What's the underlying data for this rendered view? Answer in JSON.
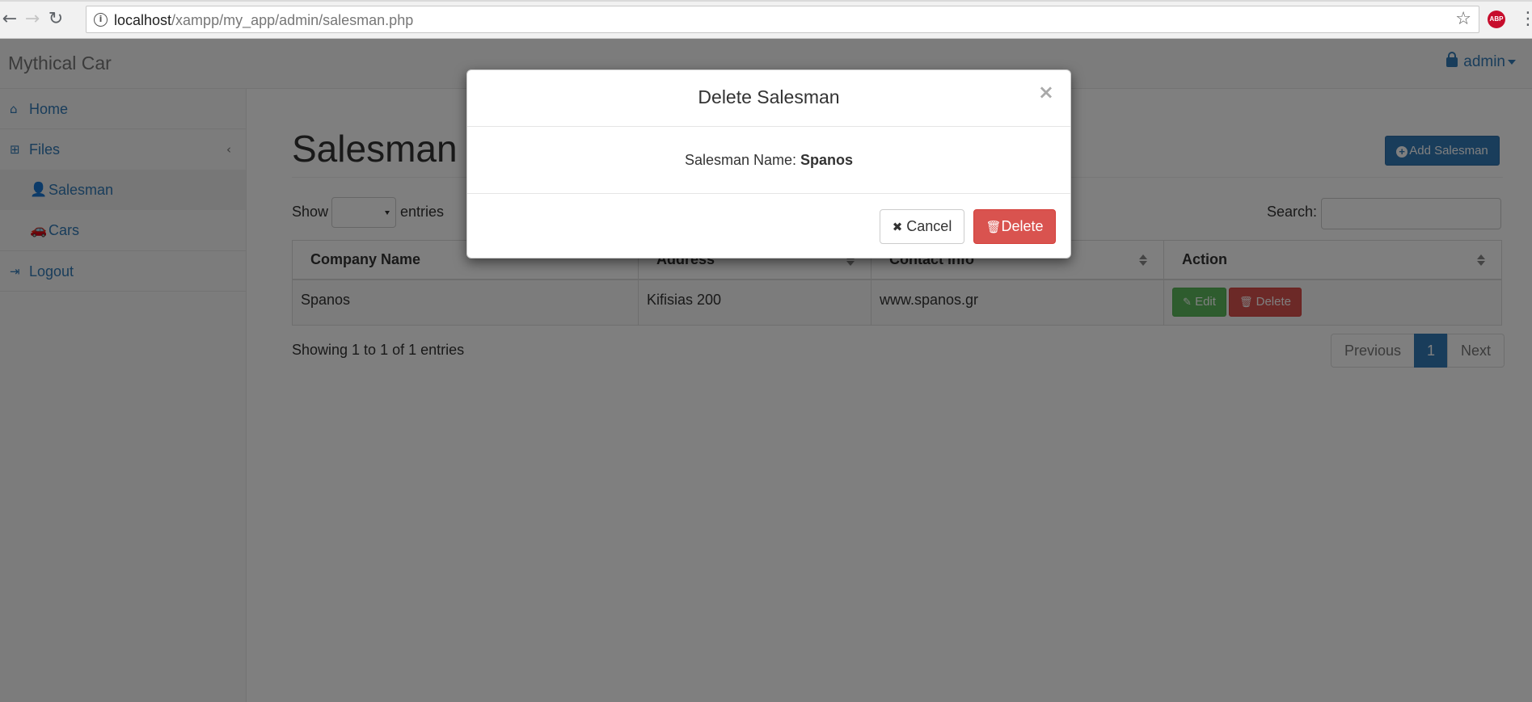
{
  "browser": {
    "url_host": "localhost",
    "url_path": "/xampp/my_app/admin/salesman.php",
    "back_icon": "arrow-left-icon",
    "forward_icon": "arrow-right-icon",
    "reload_icon": "reload-icon",
    "adblock_label": "ABP"
  },
  "app": {
    "brand": "Mythical Car",
    "user": "admin"
  },
  "sidebar": {
    "home": "Home",
    "files": "Files",
    "salesman": "Salesman",
    "cars": "Cars",
    "logout": "Logout"
  },
  "page": {
    "title": "Salesman",
    "add_button": "Add Salesman",
    "show_label": "Show",
    "entries_label": "entries",
    "length_value": "",
    "search_label": "Search:",
    "search_value": ""
  },
  "table": {
    "columns": [
      "Company Name",
      "Address",
      "Contact info",
      "Action"
    ],
    "rows": [
      {
        "company": "Spanos",
        "address": "Kifisias 200",
        "contact": "www.spanos.gr",
        "edit": "Edit",
        "delete": "Delete"
      }
    ]
  },
  "footer": {
    "info": "Showing 1 to 1 of 1 entries",
    "previous": "Previous",
    "page": "1",
    "next": "Next"
  },
  "modal": {
    "title": "Delete Salesman",
    "close": "×",
    "label": "Salesman Name:",
    "value": "Spanos",
    "cancel": "Cancel",
    "confirm": "Delete"
  },
  "colors": {
    "primary": "#337ab7",
    "success": "#5cb85c",
    "danger": "#d9534f",
    "backdrop": "rgba(0,0,0,0.5)"
  }
}
